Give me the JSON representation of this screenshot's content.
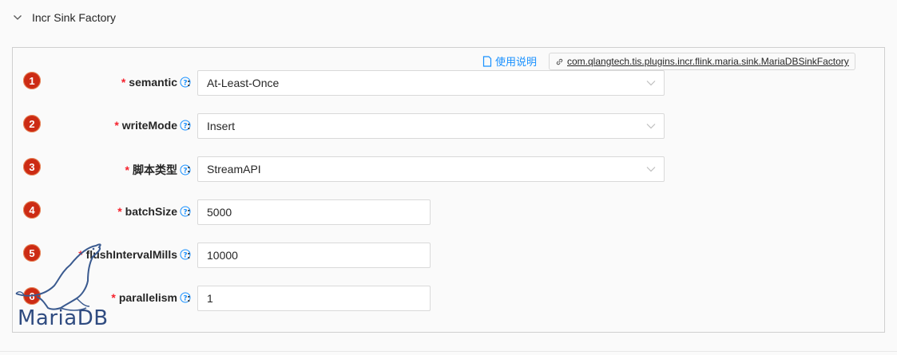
{
  "panel": {
    "title": "Incr Sink Factory"
  },
  "header_links": {
    "help_label": "使用说明",
    "class_name": "com.qlangtech.tis.plugins.incr.flink.maria.sink.MariaDBSinkFactory"
  },
  "fields": [
    {
      "badge": "1",
      "label": "semantic",
      "type": "select",
      "value": "At-Least-Once"
    },
    {
      "badge": "2",
      "label": "writeMode",
      "type": "select",
      "value": "Insert"
    },
    {
      "badge": "3",
      "label": "脚本类型",
      "type": "select",
      "value": "StreamAPI"
    },
    {
      "badge": "4",
      "label": "batchSize",
      "type": "input",
      "value": "5000"
    },
    {
      "badge": "5",
      "label": "flushIntervalMills",
      "type": "input",
      "value": "10000"
    },
    {
      "badge": "6",
      "label": "parallelism",
      "type": "input",
      "value": "1"
    }
  ],
  "required_mark": "*",
  "colon": ":",
  "logo": {
    "text": "MariaDB"
  },
  "icons": {
    "collapse": "chevron-down-icon",
    "help": "question-circle-icon",
    "doc": "file-icon",
    "link": "link-icon",
    "select_arrow": "chevron-down-icon"
  },
  "colors": {
    "accent": "#1890ff",
    "required": "#f5222d",
    "badge": "#cc2b14",
    "logo": "#2f4b80"
  }
}
